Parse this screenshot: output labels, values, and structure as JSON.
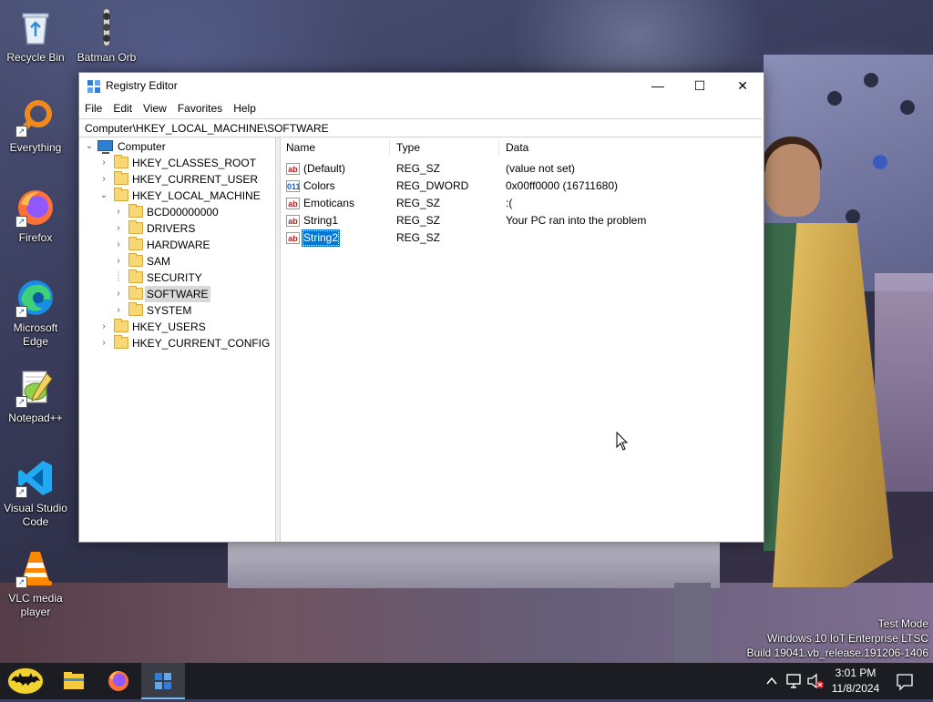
{
  "desktop": {
    "icons": [
      {
        "label": "Recycle Bin",
        "icon": "recycle-bin-icon"
      },
      {
        "label": "Batman Orb",
        "icon": "batman-orb-icon"
      },
      {
        "label": "Everything",
        "icon": "everything-search-icon"
      },
      {
        "label": "Firefox",
        "icon": "firefox-icon"
      },
      {
        "label": "Microsoft Edge",
        "icon": "edge-icon"
      },
      {
        "label": "Notepad++",
        "icon": "notepad-plus-plus-icon"
      },
      {
        "label": "Visual Studio Code",
        "icon": "vscode-icon"
      },
      {
        "label": "VLC media player",
        "icon": "vlc-icon"
      }
    ],
    "watermark": {
      "line1": "Test Mode",
      "line2": "Windows 10 IoT Enterprise LTSC",
      "line3": "Build 19041.vb_release.191206-1406"
    }
  },
  "window": {
    "title": "Registry Editor",
    "controls": {
      "minimize": "—",
      "maximize": "☐",
      "close": "✕"
    },
    "menu": [
      "File",
      "Edit",
      "View",
      "Favorites",
      "Help"
    ],
    "address": "Computer\\HKEY_LOCAL_MACHINE\\SOFTWARE",
    "tree": {
      "root": "Computer",
      "hives": [
        {
          "label": "HKEY_CLASSES_ROOT",
          "expanded": false
        },
        {
          "label": "HKEY_CURRENT_USER",
          "expanded": false
        },
        {
          "label": "HKEY_LOCAL_MACHINE",
          "expanded": true,
          "children": [
            {
              "label": "BCD00000000",
              "has_children": true
            },
            {
              "label": "DRIVERS",
              "has_children": true
            },
            {
              "label": "HARDWARE",
              "has_children": true
            },
            {
              "label": "SAM",
              "has_children": true
            },
            {
              "label": "SECURITY",
              "has_children": false
            },
            {
              "label": "SOFTWARE",
              "has_children": true,
              "selected": true
            },
            {
              "label": "SYSTEM",
              "has_children": true
            }
          ]
        },
        {
          "label": "HKEY_USERS",
          "expanded": false
        },
        {
          "label": "HKEY_CURRENT_CONFIG",
          "expanded": false
        }
      ]
    },
    "list": {
      "columns": [
        "Name",
        "Type",
        "Data"
      ],
      "rows": [
        {
          "name": "(Default)",
          "type": "REG_SZ",
          "data": "(value not set)",
          "icon": "ab"
        },
        {
          "name": "Colors",
          "type": "REG_DWORD",
          "data": "0x00ff0000 (16711680)",
          "icon": "bin"
        },
        {
          "name": "Emoticans",
          "type": "REG_SZ",
          "data": ":(",
          "icon": "ab"
        },
        {
          "name": "String1",
          "type": "REG_SZ",
          "data": "Your PC ran into the problem",
          "icon": "ab"
        },
        {
          "name": "String2",
          "type": "REG_SZ",
          "data": "",
          "icon": "ab",
          "selected": true
        }
      ]
    }
  },
  "taskbar": {
    "items": [
      "start-batman-icon",
      "file-explorer-icon",
      "firefox-icon",
      "registry-editor-icon"
    ],
    "active_item": "registry-editor-icon",
    "tray": [
      "chevron-up-icon",
      "network-icon",
      "volume-muted-icon"
    ],
    "time": "3:01 PM",
    "date": "11/8/2024"
  },
  "colors": {
    "selection": "#0078d7",
    "taskbar": "#1c1d22",
    "folder": "#f8d775"
  }
}
